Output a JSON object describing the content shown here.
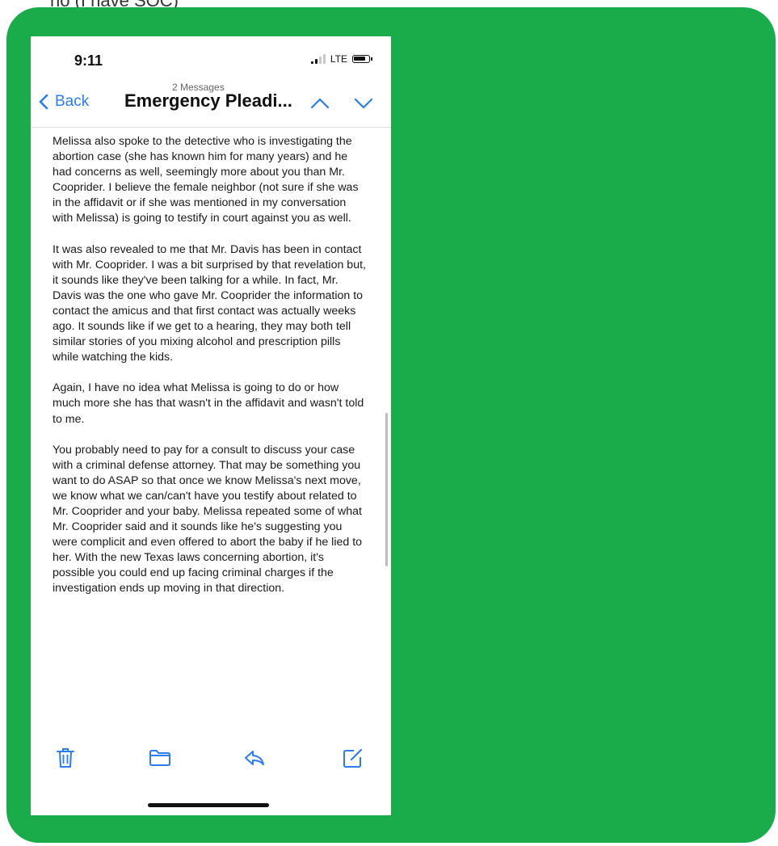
{
  "caption": "no (I have SOC)",
  "status": {
    "time": "9:11",
    "network": "LTE"
  },
  "nav": {
    "back_label": "Back",
    "subtitle": "2 Messages",
    "title": "Emergency Pleadi..."
  },
  "email": {
    "paragraphs": [
      "Melissa also spoke to the detective who is investigating the abortion case (she has known him for many years) and he had concerns as well, seemingly more about you than Mr. Cooprider. I believe the female neighbor (not sure if she was in the affidavit or if she was mentioned in my conversation with Melissa)  is going to testify in court against you as well.",
      "It was also revealed to me that Mr. Davis has been in contact with Mr. Cooprider. I was a bit surprised by that revelation but, it sounds like they've been talking for a while. In fact, Mr. Davis was the one who gave Mr. Cooprider the information to contact the amicus and that first contact was actually weeks ago. It sounds like if we get to a hearing, they may both tell similar stories of you mixing alcohol and prescription pills while watching the kids.",
      "Again, I have no idea what Melissa is going to do or how much more she has that wasn't in the affidavit and wasn't told to me.",
      "You probably need to pay for a consult to discuss your case with a criminal defense attorney. That may be something you want to do ASAP so that once we know Melissa's next move, we know what we can/can't have you testify about related to Mr. Cooprider and your baby. Melissa repeated some of what Mr. Cooprider said and it sounds like he's suggesting you were complicit and even offered to abort the baby if he lied to her. With the new Texas laws concerning abortion, it's possible you could end up facing criminal charges if the investigation ends up moving in that direction."
    ]
  },
  "toolbar": {
    "icons": [
      "trash-icon",
      "folder-icon",
      "reply-icon",
      "compose-icon"
    ]
  },
  "colors": {
    "accent": "#2b7cf6",
    "background_card": "#1aab4b"
  }
}
